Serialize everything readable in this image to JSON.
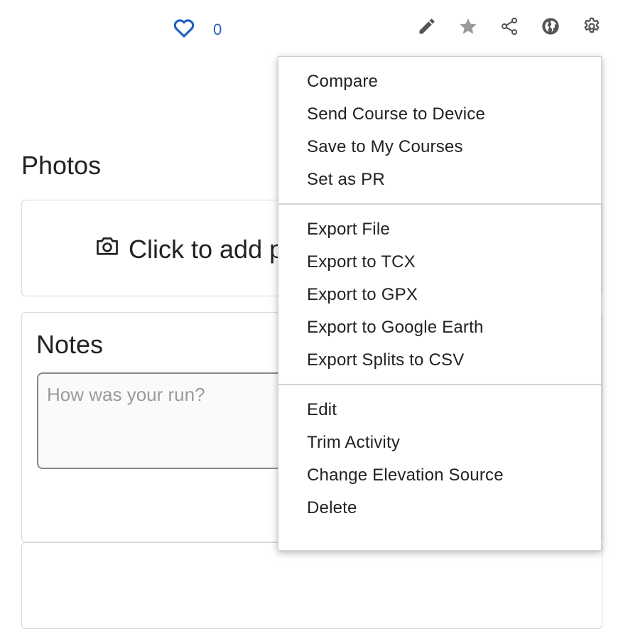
{
  "toolbar": {
    "like_count": "0",
    "icons": [
      "heart-icon",
      "pencil-icon",
      "star-icon",
      "share-icon",
      "globe-icon",
      "gear-icon"
    ],
    "colors": {
      "like": "#1f5fbf",
      "icon": "#555555",
      "star": "#9a9a9a"
    }
  },
  "photos": {
    "title": "Photos",
    "add_label": "Click to add p"
  },
  "notes": {
    "title": "Notes",
    "placeholder": "How was your run?",
    "value": ""
  },
  "menu": {
    "groups": [
      {
        "items": [
          "Compare",
          "Send Course to Device",
          "Save to My Courses",
          "Set as PR"
        ]
      },
      {
        "items": [
          "Export File",
          "Export to TCX",
          "Export to GPX",
          "Export to Google Earth",
          "Export Splits to CSV"
        ]
      },
      {
        "items": [
          "Edit",
          "Trim Activity",
          "Change Elevation Source",
          "Delete"
        ]
      }
    ]
  }
}
